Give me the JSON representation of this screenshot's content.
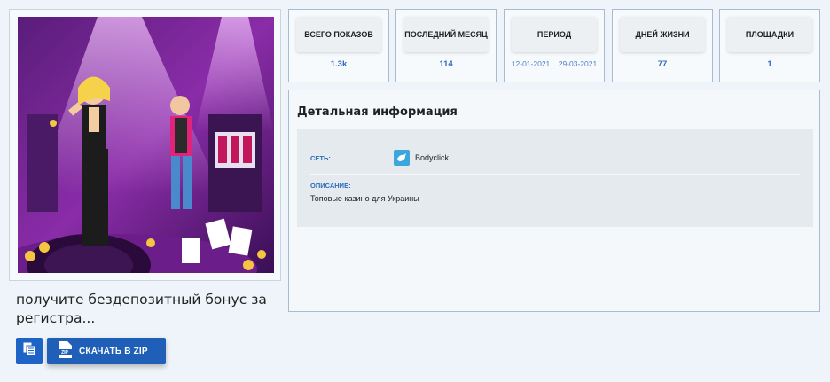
{
  "creative": {
    "title": "получите бездепозитный бонус за регистра...",
    "image_alt": "casino-ad-illustration"
  },
  "actions": {
    "copy_icon": "copy-icon",
    "zip_icon": "zip-file-icon",
    "zip_label": "СКАЧАТЬ В ZIP"
  },
  "stats": [
    {
      "label": "ВСЕГО ПОКАЗОВ",
      "value": "1.3k"
    },
    {
      "label": "ПОСЛЕДНИЙ МЕСЯЦ",
      "value": "114"
    },
    {
      "label": "ПЕРИОД",
      "value": "12-01-2021 .. 29-03-2021"
    },
    {
      "label": "ДНЕЙ ЖИЗНИ",
      "value": "77"
    },
    {
      "label": "ПЛОЩАДКИ",
      "value": "1"
    }
  ],
  "details": {
    "heading": "Детальная информация",
    "network_label": "СЕТЬ:",
    "network_name": "Bodyclick",
    "network_icon": "bird-logo-icon",
    "description_label": "ОПИСАНИЕ:",
    "description": "Топовые казино для Украины"
  },
  "colors": {
    "accent": "#1f5fb8",
    "value_text": "#2d6bbd",
    "background": "#eef4f9"
  }
}
